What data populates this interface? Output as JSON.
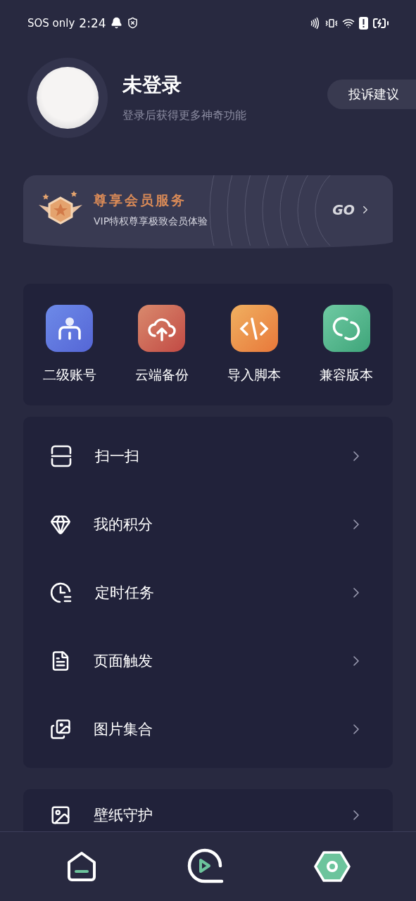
{
  "status_bar": {
    "carrier": "SOS only",
    "time": "2:24"
  },
  "profile": {
    "name": "未登录",
    "subtitle": "登录后获得更多神奇功能"
  },
  "feedback_button": "投诉建议",
  "vip": {
    "title": "尊享会员服务",
    "subtitle": "VIP特权尊享极致会员体验",
    "action": "GO"
  },
  "shortcuts": [
    {
      "label": "二级账号"
    },
    {
      "label": "云端备份"
    },
    {
      "label": "导入脚本"
    },
    {
      "label": "兼容版本"
    }
  ],
  "menu": [
    {
      "label": "扫一扫"
    },
    {
      "label": "我的积分"
    },
    {
      "label": "定时任务"
    },
    {
      "label": "页面触发"
    },
    {
      "label": "图片集合"
    }
  ],
  "menu_2": [
    {
      "label": "壁纸守护"
    }
  ],
  "bottom_nav": [
    {
      "selected": false
    },
    {
      "selected": false
    },
    {
      "selected": true
    }
  ]
}
